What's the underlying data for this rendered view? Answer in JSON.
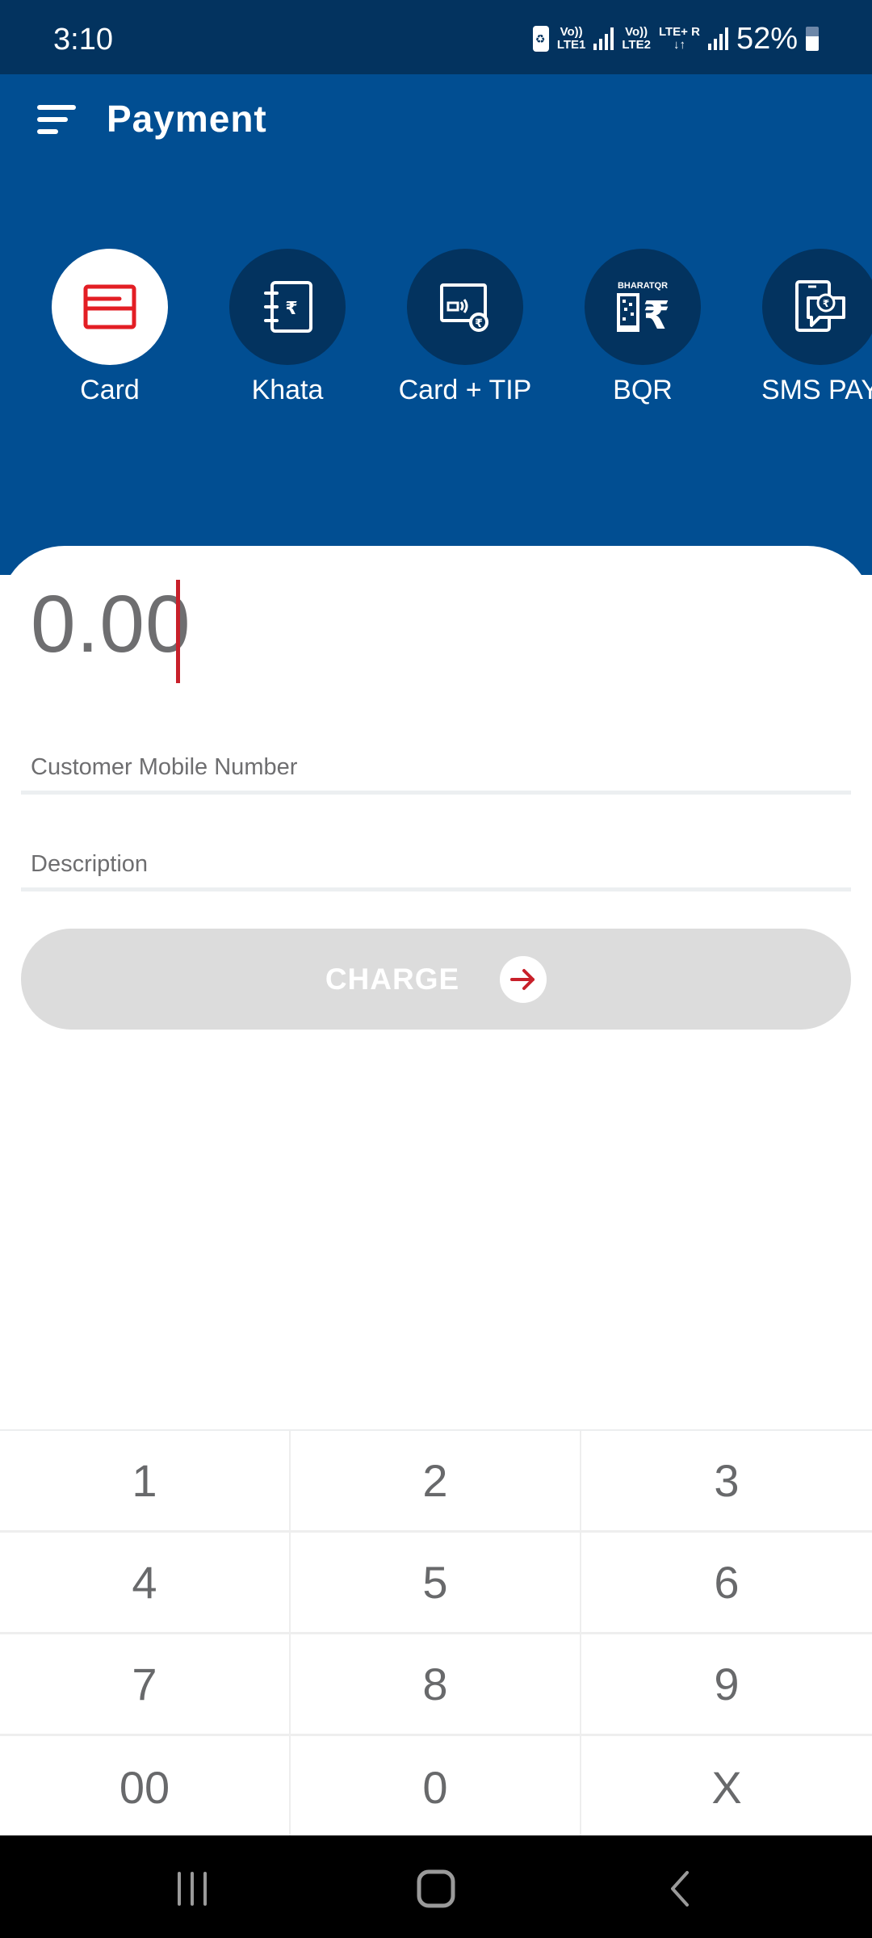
{
  "status_bar": {
    "time": "3:10",
    "sim1_top": "Vo))",
    "sim1_bottom": "LTE1",
    "sim2_top": "Vo))",
    "sim2_bottom": "LTE2",
    "sim2_network": "LTE+",
    "roaming": "R",
    "battery_percent": "52%",
    "battery_level": 0.52
  },
  "header": {
    "title": "Payment",
    "menu_icon": "hamburger-menu-icon"
  },
  "payment_modes": [
    {
      "label": "Card",
      "icon": "credit-card-icon",
      "active": true
    },
    {
      "label": "Khata",
      "icon": "ledger-rupee-icon",
      "active": false
    },
    {
      "label": "Card + TIP",
      "icon": "card-tap-rupee-icon",
      "active": false
    },
    {
      "label": "BQR",
      "icon": "bharat-qr-icon",
      "icon_text": "BHARATQR",
      "active": false
    },
    {
      "label": "SMS PAY",
      "icon": "sms-pay-icon",
      "active": false
    }
  ],
  "form": {
    "amount": "0.00",
    "mobile_placeholder": "Customer Mobile Number",
    "mobile_value": "",
    "description_placeholder": "Description",
    "description_value": "",
    "charge_label": "CHARGE"
  },
  "keypad": {
    "keys": [
      "1",
      "2",
      "3",
      "4",
      "5",
      "6",
      "7",
      "8",
      "9",
      "00",
      "0",
      "X"
    ]
  },
  "colors": {
    "primary_blue": "#014e92",
    "dark_blue": "#03335f",
    "accent_red": "#c8202a",
    "disabled_gray": "#dcdcdc"
  },
  "nav_bar": {
    "recents": "recents-icon",
    "home": "home-icon",
    "back": "back-icon"
  }
}
